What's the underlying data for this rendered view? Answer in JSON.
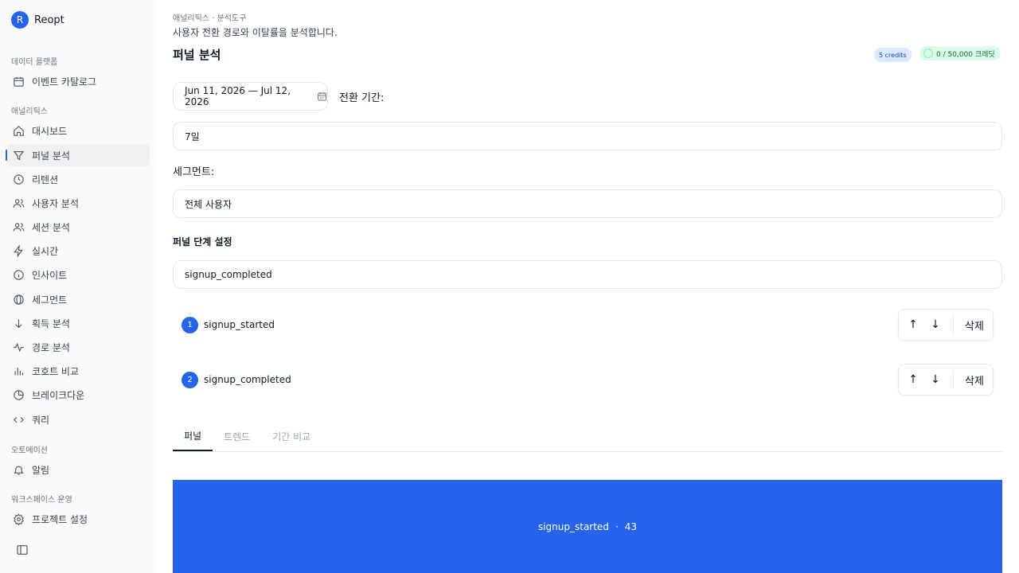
{
  "brand": {
    "initial": "R",
    "name": "Reopt"
  },
  "sidebar": {
    "sections": [
      {
        "label": "데이터 플랫폼"
      },
      {
        "label": "애널리틱스"
      },
      {
        "label": "오토메이션"
      },
      {
        "label": "워크스페이스 운영"
      }
    ],
    "items": [
      {
        "label": "이벤트 카탈로그",
        "icon": "calendar-icon"
      },
      {
        "label": "대시보드",
        "icon": "home-icon"
      },
      {
        "label": "퍼널 분석",
        "icon": "funnel-icon",
        "active": true
      },
      {
        "label": "리텐션",
        "icon": "clock-icon"
      },
      {
        "label": "사용자 분석",
        "icon": "users-icon"
      },
      {
        "label": "세션 분석",
        "icon": "users-icon"
      },
      {
        "label": "실시간",
        "icon": "lightning-icon"
      },
      {
        "label": "인사이트",
        "icon": "info-icon"
      },
      {
        "label": "세그먼트",
        "icon": "segment-icon"
      },
      {
        "label": "획득 분석",
        "icon": "arrow-down-icon"
      },
      {
        "label": "경로 분석",
        "icon": "activity-icon"
      },
      {
        "label": "코호트 비교",
        "icon": "bar-chart-icon"
      },
      {
        "label": "브레이크다운",
        "icon": "pie-chart-icon"
      },
      {
        "label": "쿼리",
        "icon": "code-icon"
      },
      {
        "label": "알림",
        "icon": "bell-icon"
      },
      {
        "label": "프로젝트 설정",
        "icon": "gear-icon"
      }
    ]
  },
  "header": {
    "breadcrumb": "애널리틱스 · 분석도구",
    "subtitle": "사용자 전환 경로와 이탈률을 분석합니다.",
    "title": "퍼널 분석",
    "credits_badge": "5 credits",
    "balance_badge": "0 / 50,000 크레딧"
  },
  "filters": {
    "date_range": "Jun 11, 2026 — Jul 12, 2026",
    "conversion_label": "전환 기간:",
    "conversion_value": "7일",
    "segment_label": "세그먼트:",
    "segment_value": "전체 사용자"
  },
  "steps": {
    "heading": "퍼널 단계 설정",
    "input_value": "signup_completed",
    "up_label": "↑",
    "down_label": "↓",
    "delete_label": "삭제",
    "items": [
      {
        "num": "1",
        "name": "signup_started"
      },
      {
        "num": "2",
        "name": "signup_completed"
      }
    ]
  },
  "tabs": [
    {
      "label": "퍼널",
      "active": true
    },
    {
      "label": "트렌드"
    },
    {
      "label": "기간 비교"
    }
  ],
  "funnel": {
    "step_name": "signup_started",
    "separator": "·",
    "count": "43"
  },
  "colors": {
    "accent": "#2563eb",
    "credits_bg": "#dbeafe",
    "balance_bg": "#dcfce7"
  }
}
